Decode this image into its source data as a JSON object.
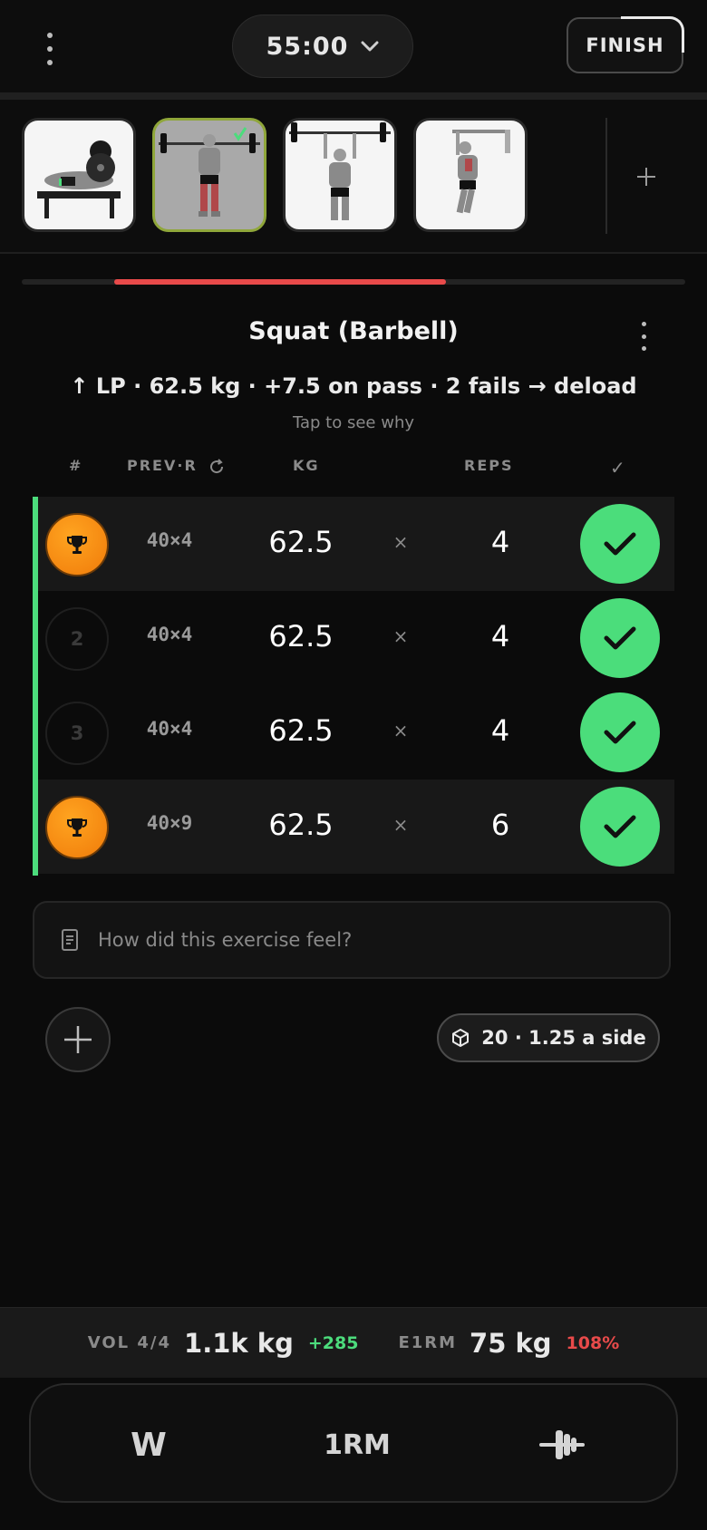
{
  "header": {
    "timer": "55:00",
    "finish_label": "FINISH"
  },
  "exercise_thumbs": [
    {
      "name": "Bench press"
    },
    {
      "name": "Squat (Barbell)",
      "active": true
    },
    {
      "name": "Overhead press"
    },
    {
      "name": "Pull up"
    }
  ],
  "progress": {
    "fraction": 0.64,
    "color": "#e84a4a"
  },
  "exercise": {
    "title": "Squat (Barbell)",
    "plan": "↑ LP · 62.5 kg · +7.5 on pass · 2 fails → deload",
    "subtitle": "Tap to see why"
  },
  "table": {
    "headers": {
      "num": "#",
      "prev": "PREV·R",
      "kg": "KG",
      "reps": "REPS",
      "check": "✓"
    },
    "rows": [
      {
        "num": "",
        "trophy": true,
        "prev": "40×4",
        "kg": "62.5",
        "times": "×",
        "reps": "4",
        "done": true
      },
      {
        "num": "2",
        "trophy": false,
        "prev": "40×4",
        "kg": "62.5",
        "times": "×",
        "reps": "4",
        "done": true
      },
      {
        "num": "3",
        "trophy": false,
        "prev": "40×4",
        "kg": "62.5",
        "times": "×",
        "reps": "4",
        "done": true
      },
      {
        "num": "",
        "trophy": true,
        "prev": "40×9",
        "kg": "62.5",
        "times": "×",
        "reps": "6",
        "done": true
      }
    ]
  },
  "notes": {
    "placeholder": "How did this exercise feel?"
  },
  "plates": {
    "label": "20 · 1.25 a side"
  },
  "stats": {
    "vol_label": "VOL 4/4",
    "vol_value": "1.1k kg",
    "vol_delta": "+285",
    "e1rm_label": "E1RM",
    "e1rm_value": "75 kg",
    "e1rm_pct": "108%"
  },
  "bottom_bar": {
    "warmup_label": "W",
    "onerm_label": "1RM",
    "plate_icon": "barbell-icon"
  },
  "colors": {
    "accent_green": "#4bdd7b",
    "accent_red": "#e84a4a",
    "trophy_orange": "#f58d12",
    "active_thumb_border": "#8fa63a"
  }
}
